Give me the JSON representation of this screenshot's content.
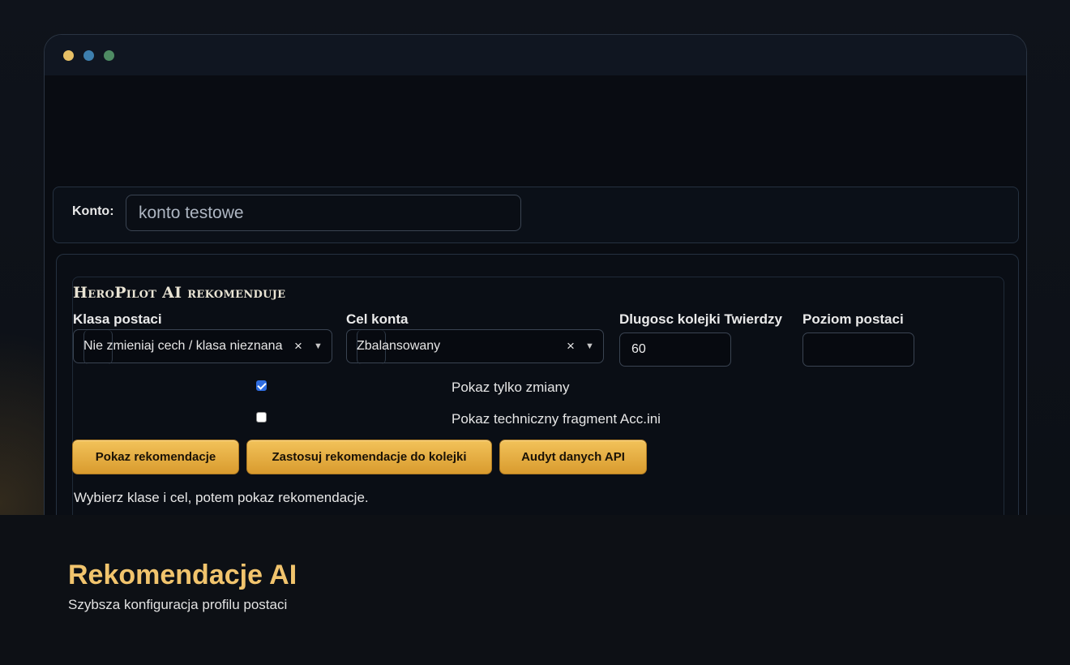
{
  "window": {
    "dots": [
      "yellow",
      "blue",
      "green"
    ]
  },
  "account": {
    "label": "Konto:",
    "value": "konto testowe"
  },
  "recommendation": {
    "title": "HeroPilot AI rekomenduje",
    "class_label": "Klasa postaci",
    "class_value": "Nie zmieniaj cech / klasa nieznana",
    "goal_label": "Cel konta",
    "goal_value": "Zbalansowany",
    "queue_label": "Dlugosc kolejki Twierdzy",
    "queue_value": "60",
    "level_label": "Poziom postaci",
    "level_value": "",
    "clear_symbol": "×",
    "caret_symbol": "▼",
    "only_changes_label": "Pokaz tylko zmiany",
    "only_changes_checked": true,
    "tech_fragment_label": "Pokaz techniczny fragment Acc.ini",
    "tech_fragment_checked": false,
    "buttons": {
      "show": "Pokaz rekomendacje",
      "apply": "Zastosuj rekomendacje do kolejki",
      "audit": "Audyt danych API"
    },
    "status": "Wybierz klase i cel, potem pokaz rekomendacje."
  },
  "caption": {
    "title": "Rekomendacje AI",
    "subtitle": "Szybsza konfiguracja profilu postaci"
  },
  "colors": {
    "accent_gold": "#f1c46d",
    "button_gold": "#e6ab3f",
    "checkbox_blue": "#2f6de0",
    "background": "#0d1016"
  }
}
